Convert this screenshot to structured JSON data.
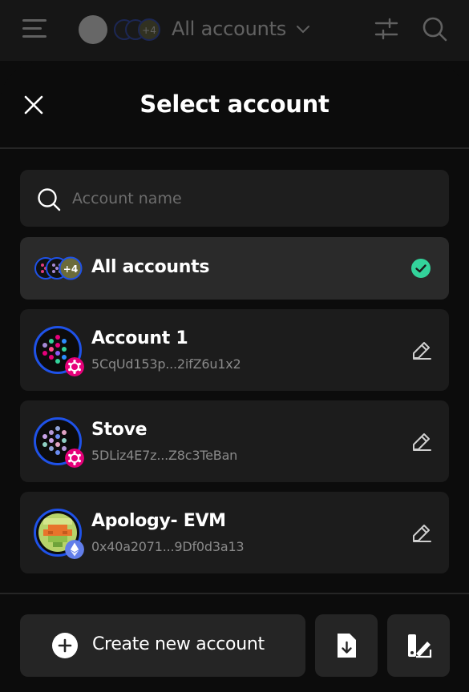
{
  "topbar": {
    "title": "All accounts",
    "avatar_more": "+4"
  },
  "sheet": {
    "title": "Select account"
  },
  "search": {
    "placeholder": "Account name"
  },
  "accounts": [
    {
      "name": "All accounts",
      "badge": "+4",
      "selected": true
    },
    {
      "name": "Account 1",
      "address": "5CqUd153p...2ifZ6u1x2",
      "chain": "polkadot"
    },
    {
      "name": "Stove",
      "address": "5DLiz4E7z...Z8c3TeBan",
      "chain": "polkadot"
    },
    {
      "name": "Apology- EVM",
      "address": "0x40a2071...9Df0d3a13",
      "chain": "ethereum"
    }
  ],
  "actions": {
    "create_label": "Create new account"
  },
  "colors": {
    "accent_blue": "#1f52e8",
    "check_green": "#33d39b",
    "polkadot_pink": "#e6007a",
    "ethereum_purple": "#627eea"
  },
  "icons": [
    "menu-icon",
    "plug-icon",
    "chevron-down-icon",
    "sliders-icon",
    "search-icon",
    "close-icon",
    "check-icon",
    "edit-icon",
    "plus-icon",
    "import-icon",
    "theme-icon"
  ]
}
